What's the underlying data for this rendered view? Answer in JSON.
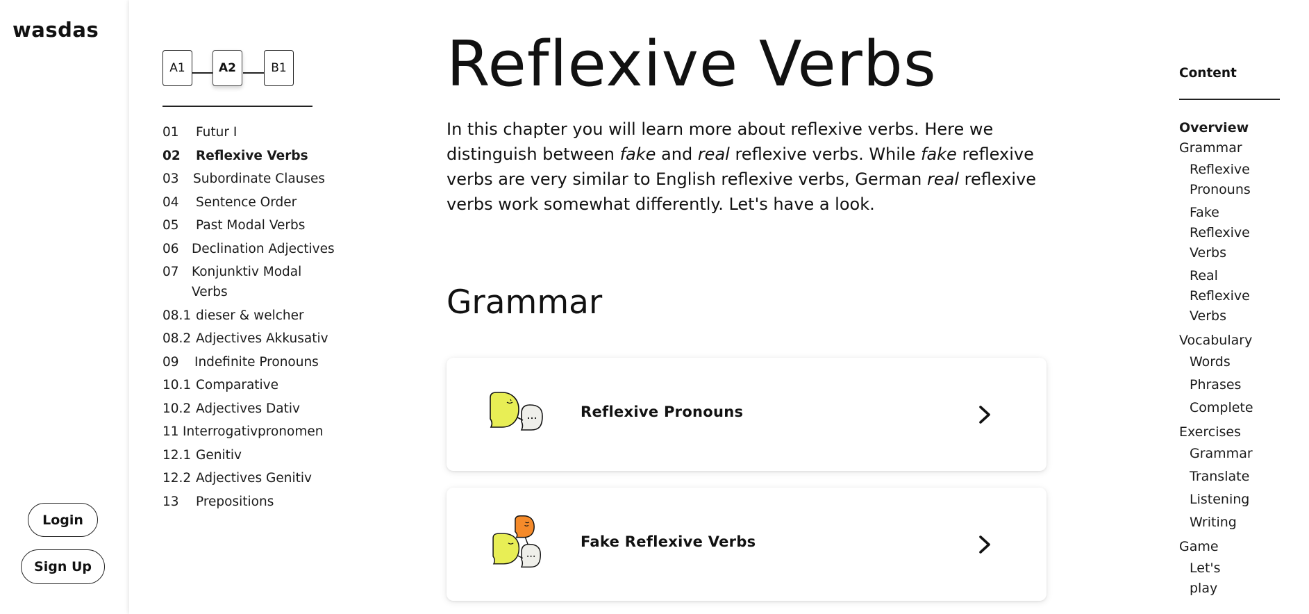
{
  "brand": {
    "logo": "wasdas"
  },
  "auth": {
    "login": "Login",
    "signup": "Sign Up"
  },
  "levels": [
    {
      "label": "A1",
      "active": false
    },
    {
      "label": "A2",
      "active": true
    },
    {
      "label": "B1",
      "active": false
    }
  ],
  "chapters": [
    {
      "num": "01",
      "title": "Futur I",
      "active": false
    },
    {
      "num": "02",
      "title": "Reflexive Verbs",
      "active": true
    },
    {
      "num": "03",
      "title": "Subordinate Clauses",
      "active": false
    },
    {
      "num": "04",
      "title": "Sentence Order",
      "active": false
    },
    {
      "num": "05",
      "title": "Past Modal Verbs",
      "active": false
    },
    {
      "num": "06",
      "title": "Declination Adjectives",
      "active": false
    },
    {
      "num": "07",
      "title": "Konjunktiv Modal Verbs",
      "active": false
    },
    {
      "num": "08.1",
      "title": "dieser & welcher",
      "active": false
    },
    {
      "num": "08.2",
      "title": "Adjectives Akkusativ",
      "active": false
    },
    {
      "num": "09",
      "title": "Indefinite Pronouns",
      "active": false
    },
    {
      "num": "10.1",
      "title": "Comparative",
      "active": false
    },
    {
      "num": "10.2",
      "title": "Adjectives Dativ",
      "active": false
    },
    {
      "num": "11",
      "title": "Interrogativpronomen",
      "active": false
    },
    {
      "num": "12.1",
      "title": "Genitiv",
      "active": false
    },
    {
      "num": "12.2",
      "title": "Adjectives Genitiv",
      "active": false
    },
    {
      "num": "13",
      "title": "Prepositions",
      "active": false
    }
  ],
  "main": {
    "title": "Reflexive Verbs",
    "intro": {
      "p1": "In this chapter you will learn more about reflexive verbs. Here we distinguish between ",
      "em1": "fake",
      "p2": " and ",
      "em2": "real",
      "p3": " reflexive verbs. While ",
      "em3": "fake",
      "p4": " reflexive verbs are very similar to English reflexive verbs, German ",
      "em4": "real",
      "p5": " reflexive verbs work somewhat differently. Let's have a look."
    },
    "section_title": "Grammar",
    "cards": [
      {
        "label": "Reflexive Pronouns",
        "illustration": "two-speech-bubbles-icon"
      },
      {
        "label": "Fake Reflexive Verbs",
        "illustration": "three-speech-bubbles-icon"
      }
    ]
  },
  "toc": {
    "heading": "Content",
    "items": [
      {
        "label": "Overview",
        "sub": false,
        "strong": true
      },
      {
        "label": "Grammar",
        "sub": false,
        "strong": false
      },
      {
        "label": "Reflexive Pronouns",
        "sub": true,
        "strong": false
      },
      {
        "label": "Fake Reflexive Verbs",
        "sub": true,
        "strong": false
      },
      {
        "label": "Real Reflexive Verbs",
        "sub": true,
        "strong": false
      },
      {
        "label": "Vocabulary",
        "sub": false,
        "strong": false
      },
      {
        "label": "Words",
        "sub": true,
        "strong": false
      },
      {
        "label": "Phrases",
        "sub": true,
        "strong": false
      },
      {
        "label": "Complete",
        "sub": true,
        "strong": false
      },
      {
        "label": "Exercises",
        "sub": false,
        "strong": false
      },
      {
        "label": "Grammar",
        "sub": true,
        "strong": false
      },
      {
        "label": "Translate",
        "sub": true,
        "strong": false
      },
      {
        "label": "Listening",
        "sub": true,
        "strong": false
      },
      {
        "label": "Writing",
        "sub": true,
        "strong": false
      },
      {
        "label": "Game",
        "sub": false,
        "strong": false
      },
      {
        "label": "Let's play",
        "sub": true,
        "strong": false
      }
    ]
  },
  "colors": {
    "bubble_yellow": "#e8ee55",
    "bubble_orange": "#f58a2a",
    "bubble_gray": "#efefea",
    "ink": "#111111"
  }
}
